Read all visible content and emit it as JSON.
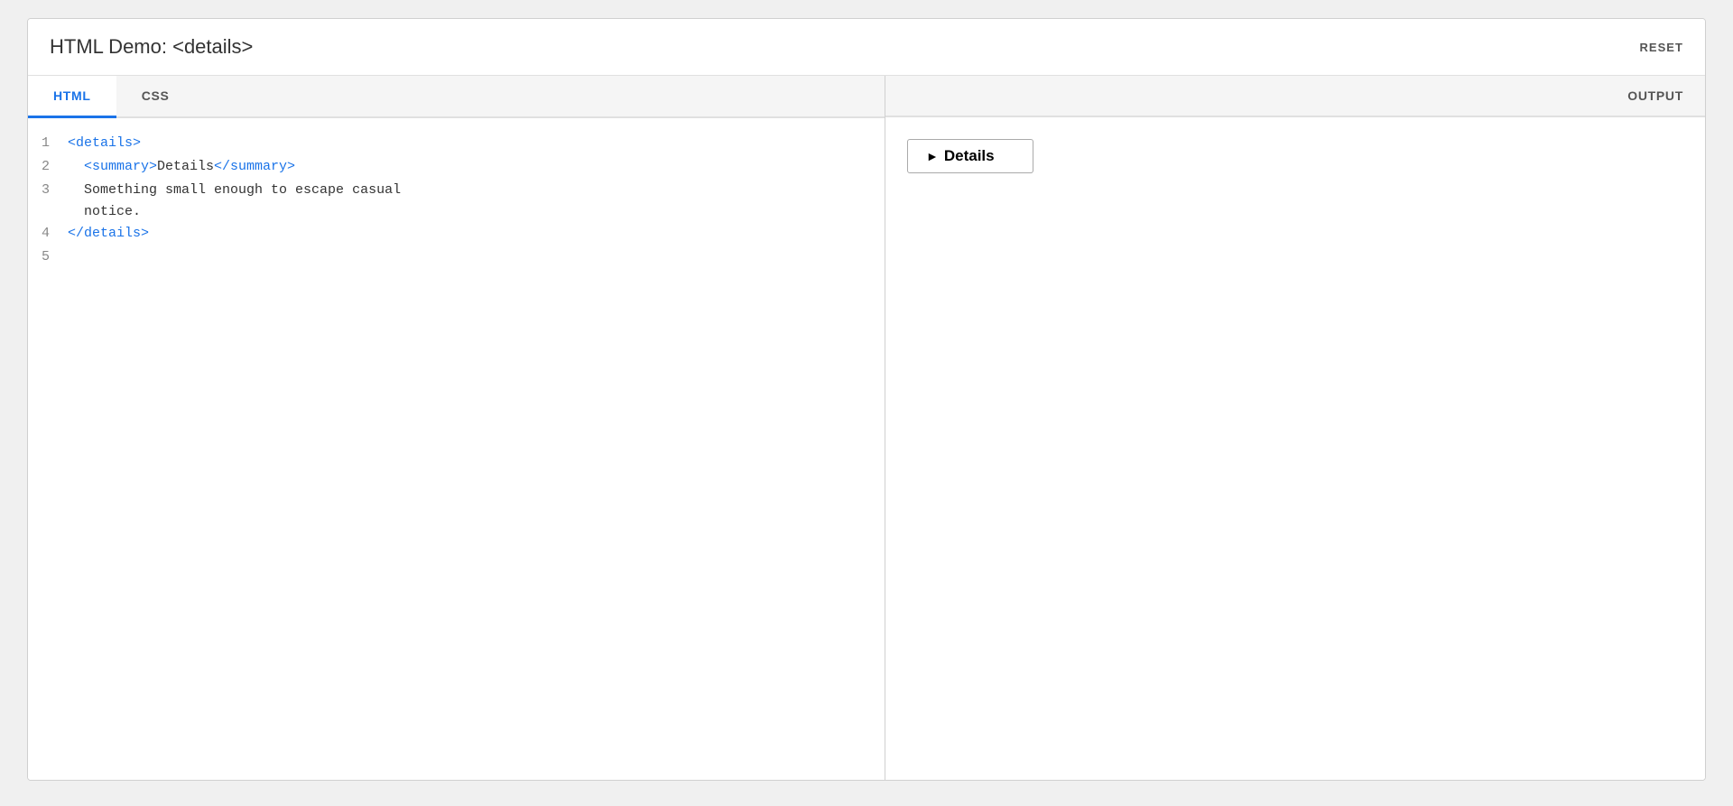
{
  "header": {
    "title": "HTML Demo: <details>",
    "reset_label": "RESET"
  },
  "tabs": [
    {
      "label": "HTML",
      "active": true
    },
    {
      "label": "CSS",
      "active": false
    }
  ],
  "output_label": "OUTPUT",
  "code_lines": [
    {
      "number": "1",
      "parts": [
        {
          "type": "tag",
          "text": "<details>"
        }
      ]
    },
    {
      "number": "2",
      "parts": [
        {
          "type": "tag",
          "text": "<summary>"
        },
        {
          "type": "text",
          "text": "Details"
        },
        {
          "type": "tag",
          "text": "</summary>"
        }
      ]
    },
    {
      "number": "3",
      "parts": [
        {
          "type": "text",
          "text": "  Something small enough to escape casual\n  notice."
        }
      ]
    },
    {
      "number": "4",
      "parts": [
        {
          "type": "tag",
          "text": "</details>"
        }
      ]
    },
    {
      "number": "5",
      "parts": []
    }
  ],
  "output": {
    "details_arrow": "►",
    "details_label": "Details"
  }
}
